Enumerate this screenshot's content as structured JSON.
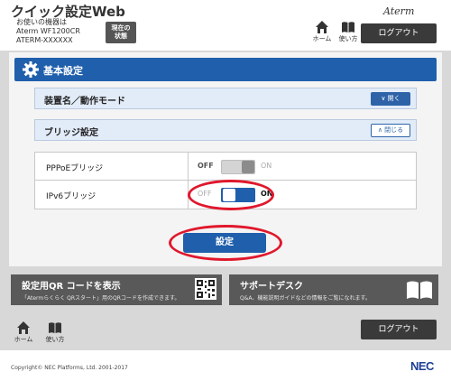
{
  "header": {
    "title": "クイック設定Web",
    "device_label": "お使いの機器は",
    "device_model": "Aterm WF1200CR",
    "device_id": "ATERM-XXXXXX",
    "status_button": "現在の状態",
    "brand": "Aterm",
    "home_label": "ホーム",
    "help_label": "使い方",
    "logout_label": "ログアウト"
  },
  "panel": {
    "title": "基本設定",
    "sections": [
      {
        "label": "装置名／動作モード",
        "button": "開く"
      },
      {
        "label": "ブリッジ設定",
        "button": "閉じる"
      }
    ],
    "settings": [
      {
        "label": "PPPoEブリッジ",
        "off_label": "OFF",
        "on_label": "ON",
        "state": "OFF"
      },
      {
        "label": "IPv6ブリッジ",
        "off_label": "OFF",
        "on_label": "ON",
        "state": "ON"
      }
    ],
    "submit_label": "設定"
  },
  "cards": [
    {
      "title": "設定用QR コードを表示",
      "desc": "「Atermらくらく QRスタート」用のQRコードを作成できます。",
      "icon": "qr-code-icon"
    },
    {
      "title": "サポートデスク",
      "desc": "Q&A、機能説明ガイドなどの情報をご覧になれます。",
      "icon": "book-icon"
    }
  ],
  "footer": {
    "home_label": "ホーム",
    "help_label": "使い方",
    "logout_label": "ログアウト",
    "copyright": "Copyright© NEC Platforms, Ltd. 2001-2017",
    "brand": "NEC"
  },
  "colors": {
    "accent_blue": "#1f5fab",
    "highlight_red": "#e0182c",
    "dark_button": "#3a3a3a"
  }
}
